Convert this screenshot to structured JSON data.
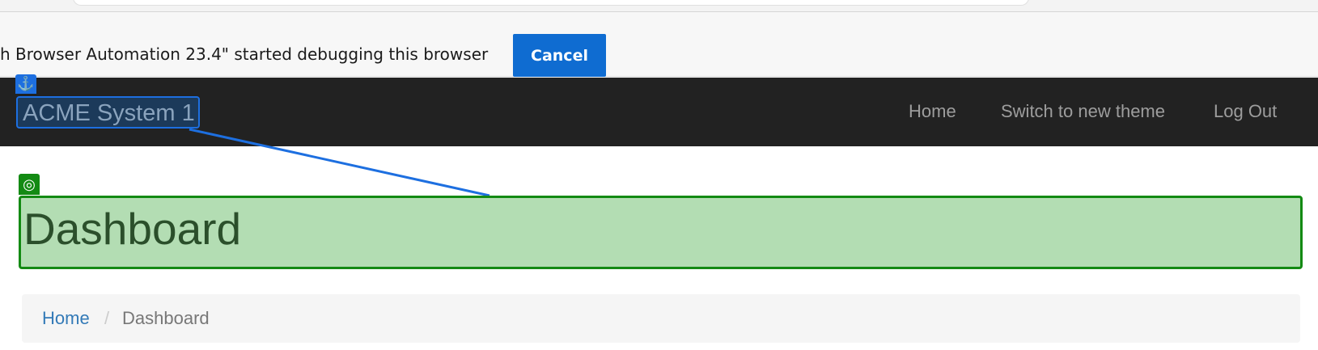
{
  "infobar": {
    "message": "h Browser Automation 23.4\" started debugging this browser",
    "cancel_label": "Cancel",
    "accent": "#0f6cd1"
  },
  "navbar": {
    "brand": "ACME System 1",
    "links": [
      "Home",
      "Switch to new theme",
      "Log Out"
    ],
    "background": "#222222"
  },
  "overlay": {
    "anchor_icon": "anchor-icon",
    "target_icon": "target-icon",
    "anchor_color": "#1d6fe0",
    "target_color": "#138a13"
  },
  "page": {
    "title": "Dashboard"
  },
  "breadcrumb": {
    "home": "Home",
    "separator": "/",
    "current": "Dashboard"
  }
}
